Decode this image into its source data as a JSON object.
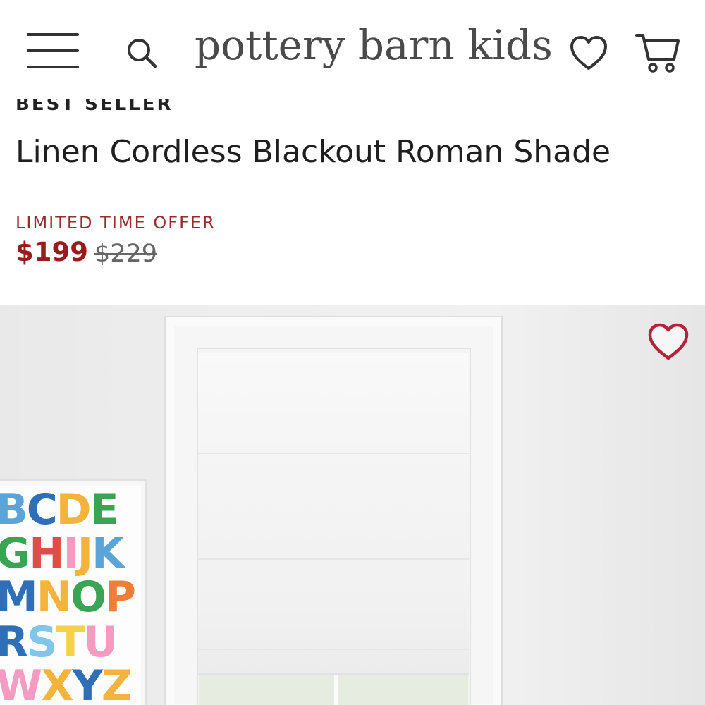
{
  "header": {
    "logo": "pottery barn kids",
    "menu_icon": "hamburger-menu-icon",
    "search_icon": "search-icon",
    "favorites_icon": "heart-outline-icon",
    "cart_icon": "shopping-cart-icon"
  },
  "product": {
    "badge": "BEST SELLER",
    "title": "Linen Cordless Blackout Roman Shade",
    "offer_label": "LIMITED TIME OFFER",
    "price_now": "$199",
    "price_was": "$229"
  },
  "poster": {
    "rows": [
      [
        {
          "c": "B",
          "color": "#5aa4d8"
        },
        {
          "c": "C",
          "color": "#2e6fb7"
        },
        {
          "c": "D",
          "color": "#f3b33d"
        },
        {
          "c": "E",
          "color": "#3aa455"
        }
      ],
      [
        {
          "c": "G",
          "color": "#3aa455"
        },
        {
          "c": "H",
          "color": "#e14b4b"
        },
        {
          "c": "I",
          "color": "#f59ac0"
        },
        {
          "c": "J",
          "color": "#f3b33d"
        },
        {
          "c": "K",
          "color": "#5aa4d8"
        }
      ],
      [
        {
          "c": "M",
          "color": "#2e6fb7"
        },
        {
          "c": "N",
          "color": "#f3b33d"
        },
        {
          "c": "O",
          "color": "#3aa455"
        },
        {
          "c": "P",
          "color": "#f07e3a"
        }
      ],
      [
        {
          "c": "R",
          "color": "#2e6fb7"
        },
        {
          "c": "S",
          "color": "#7fc6e8"
        },
        {
          "c": "T",
          "color": "#f3d24a"
        },
        {
          "c": "U",
          "color": "#f59ac0"
        }
      ],
      [
        {
          "c": "W",
          "color": "#f59ac0"
        },
        {
          "c": "X",
          "color": "#f3b33d"
        },
        {
          "c": "Y",
          "color": "#2e6fb7"
        },
        {
          "c": "Z",
          "color": "#f3b33d"
        }
      ]
    ]
  },
  "colors": {
    "accent_red": "#9b1a1a",
    "heart_red": "#b3243a",
    "text_dark": "#222222"
  },
  "save_icon": "heart-save-icon"
}
